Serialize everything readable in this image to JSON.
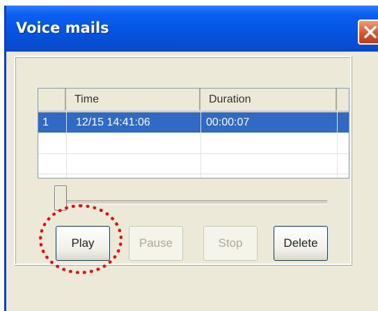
{
  "window": {
    "title": "Voice mails"
  },
  "table": {
    "columns": [
      "",
      "Time",
      "Duration"
    ],
    "rows": [
      {
        "index": "1",
        "time": "12/15 14:41:06",
        "duration": "00:00:07",
        "selected": true
      }
    ]
  },
  "controls": {
    "play": "Play",
    "pause": "Pause",
    "stop": "Stop",
    "delete": "Delete"
  },
  "slider": {
    "position_fraction": 0.0
  },
  "colors": {
    "titlebar": "#0553e0",
    "selection": "#316ac5",
    "callout": "#e01010",
    "close": "#d9542f"
  }
}
